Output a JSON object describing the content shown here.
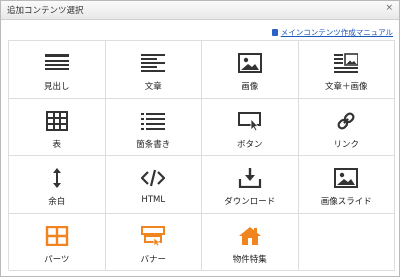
{
  "dialog": {
    "title": "追加コンテンツ選択",
    "close": "×",
    "manual_link": "メインコンテンツ作成マニュアル"
  },
  "items": [
    {
      "label": "見出し",
      "icon": "heading-icon"
    },
    {
      "label": "文章",
      "icon": "text-icon"
    },
    {
      "label": "画像",
      "icon": "image-icon"
    },
    {
      "label": "文章＋画像",
      "icon": "text-image-icon"
    },
    {
      "label": "表",
      "icon": "table-icon"
    },
    {
      "label": "箇条書き",
      "icon": "list-icon"
    },
    {
      "label": "ボタン",
      "icon": "button-icon"
    },
    {
      "label": "リンク",
      "icon": "link-icon"
    },
    {
      "label": "余白",
      "icon": "spacing-icon"
    },
    {
      "label": "HTML",
      "icon": "code-icon"
    },
    {
      "label": "ダウンロード",
      "icon": "download-icon"
    },
    {
      "label": "画像スライド",
      "icon": "slideshow-icon"
    },
    {
      "label": "パーツ",
      "icon": "parts-icon"
    },
    {
      "label": "バナー",
      "icon": "banner-icon"
    },
    {
      "label": "物件特集",
      "icon": "house-icon"
    }
  ],
  "colors": {
    "icon": "#333333",
    "accent": "#f0841e",
    "link": "#1a57b8"
  }
}
